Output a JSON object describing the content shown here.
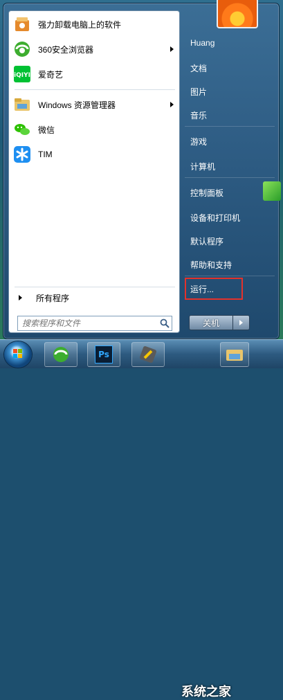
{
  "programs": [
    {
      "label": "强力卸载电脑上的软件",
      "icon": "uninstall-icon",
      "has_submenu": false
    },
    {
      "label": "360安全浏览器",
      "icon": "browser-360-icon",
      "has_submenu": true
    },
    {
      "label": "爱奇艺",
      "icon": "iqiyi-icon",
      "has_submenu": false
    },
    {
      "label": "Windows 资源管理器",
      "icon": "explorer-folder-icon",
      "has_submenu": true
    },
    {
      "label": "微信",
      "icon": "wechat-icon",
      "has_submenu": false
    },
    {
      "label": "TIM",
      "icon": "tim-icon",
      "has_submenu": false
    }
  ],
  "all_programs_label": "所有程序",
  "search": {
    "placeholder": "搜索程序和文件"
  },
  "right_pane": {
    "user": "Huang",
    "items": [
      "文档",
      "图片",
      "音乐",
      "游戏",
      "计算机",
      "控制面板",
      "设备和打印机",
      "默认程序",
      "帮助和支持",
      "运行..."
    ]
  },
  "shutdown_label": "关机",
  "taskbar": {
    "buttons": [
      "browser-360-icon",
      "photoshop-icon",
      "flashfxp-icon",
      "explorer-folder-icon"
    ],
    "photoshop_text": "Ps"
  },
  "watermark": "系统之家",
  "colors": {
    "highlight": "#e4322b",
    "accent": "#1d4f6e"
  }
}
